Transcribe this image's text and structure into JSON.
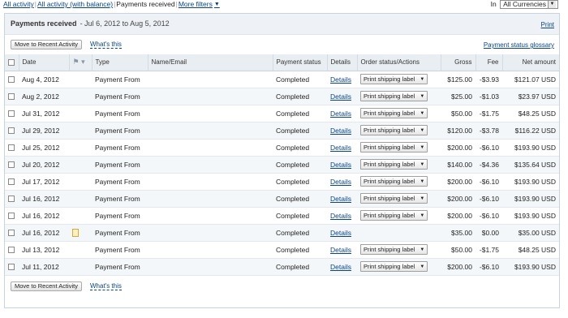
{
  "filters": {
    "links": [
      "All activity",
      "All activity (with balance)"
    ],
    "current": "Payments received",
    "more_filters": "More filters",
    "in_label": "In",
    "currency_value": "All Currencies"
  },
  "panel": {
    "title": "Payments received",
    "range": "- Jul 6, 2012 to Aug 5, 2012",
    "print": "Print",
    "move_button": "Move to Recent Activity",
    "whats_this": "What's this",
    "glossary": "Payment status glossary"
  },
  "columns": {
    "date": "Date",
    "type": "Type",
    "name": "Name/Email",
    "status": "Payment status",
    "details": "Details",
    "order": "Order status/Actions",
    "gross": "Gross",
    "fee": "Fee",
    "net": "Net amount"
  },
  "rows": [
    {
      "date": "Aug 4, 2012",
      "type": "Payment From",
      "name": "",
      "status": "Completed",
      "details": "Details",
      "action": "Print shipping label",
      "gross": "$125.00",
      "fee": "-$3.93",
      "net": "$121.07 USD",
      "note": false
    },
    {
      "date": "Aug 2, 2012",
      "type": "Payment From",
      "name": "",
      "status": "Completed",
      "details": "Details",
      "action": "Print shipping label",
      "gross": "$25.00",
      "fee": "-$1.03",
      "net": "$23.97 USD",
      "note": false
    },
    {
      "date": "Jul 31, 2012",
      "type": "Payment From",
      "name": "",
      "status": "Completed",
      "details": "Details",
      "action": "Print shipping label",
      "gross": "$50.00",
      "fee": "-$1.75",
      "net": "$48.25 USD",
      "note": false
    },
    {
      "date": "Jul 29, 2012",
      "type": "Payment From",
      "name": "",
      "status": "Completed",
      "details": "Details",
      "action": "Print shipping label",
      "gross": "$120.00",
      "fee": "-$3.78",
      "net": "$116.22 USD",
      "note": false
    },
    {
      "date": "Jul 25, 2012",
      "type": "Payment From",
      "name": "",
      "status": "Completed",
      "details": "Details",
      "action": "Print shipping label",
      "gross": "$200.00",
      "fee": "-$6.10",
      "net": "$193.90 USD",
      "note": false
    },
    {
      "date": "Jul 20, 2012",
      "type": "Payment From",
      "name": "",
      "status": "Completed",
      "details": "Details",
      "action": "Print shipping label",
      "gross": "$140.00",
      "fee": "-$4.36",
      "net": "$135.64 USD",
      "note": false
    },
    {
      "date": "Jul 17, 2012",
      "type": "Payment From",
      "name": "",
      "status": "Completed",
      "details": "Details",
      "action": "Print shipping label",
      "gross": "$200.00",
      "fee": "-$6.10",
      "net": "$193.90 USD",
      "note": false
    },
    {
      "date": "Jul 16, 2012",
      "type": "Payment From",
      "name": "",
      "status": "Completed",
      "details": "Details",
      "action": "Print shipping label",
      "gross": "$200.00",
      "fee": "-$6.10",
      "net": "$193.90 USD",
      "note": false
    },
    {
      "date": "Jul 16, 2012",
      "type": "Payment From",
      "name": "",
      "status": "Completed",
      "details": "Details",
      "action": "Print shipping label",
      "gross": "$200.00",
      "fee": "-$6.10",
      "net": "$193.90 USD",
      "note": false
    },
    {
      "date": "Jul 16, 2012",
      "type": "Payment From",
      "name": "",
      "status": "Completed",
      "details": "Details",
      "action": "",
      "gross": "$35.00",
      "fee": "$0.00",
      "net": "$35.00 USD",
      "note": true
    },
    {
      "date": "Jul 13, 2012",
      "type": "Payment From",
      "name": "",
      "status": "Completed",
      "details": "Details",
      "action": "Print shipping label",
      "gross": "$50.00",
      "fee": "-$1.75",
      "net": "$48.25 USD",
      "note": false
    },
    {
      "date": "Jul 11, 2012",
      "type": "Payment From",
      "name": "",
      "status": "Completed",
      "details": "Details",
      "action": "Print shipping label",
      "gross": "$200.00",
      "fee": "-$6.10",
      "net": "$193.90 USD",
      "note": false
    }
  ]
}
